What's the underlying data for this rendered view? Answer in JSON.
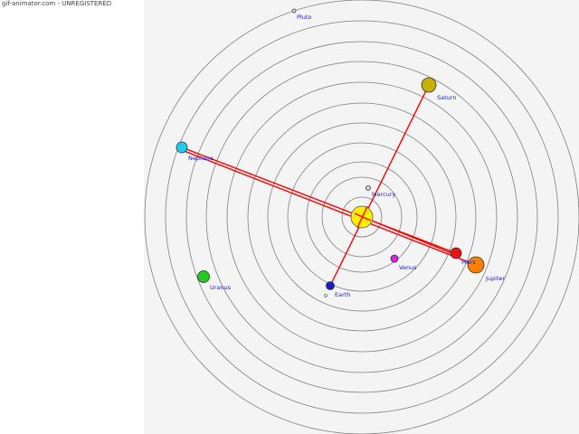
{
  "watermark": "gif-animator.com - UNREGISTERED",
  "colors": {
    "panel_bg": "#f4f4f4",
    "orbit": "#808080",
    "line": "#ff0000",
    "label": "#1a1acc"
  },
  "sun": {
    "color": "#ffee00"
  },
  "planets": [
    {
      "name": "Mercury",
      "color": "#d8d8d8",
      "label": "Mercury"
    },
    {
      "name": "Venus",
      "color": "#e020e0",
      "label": "Venus"
    },
    {
      "name": "Earth",
      "color": "#1a1acc",
      "label": "Earth"
    },
    {
      "name": "Mars",
      "color": "#ee1111",
      "label": "Mars"
    },
    {
      "name": "Jupiter",
      "color": "#ff8000",
      "label": "Jupiter"
    },
    {
      "name": "Saturn",
      "color": "#c8b000",
      "label": "Saturn"
    },
    {
      "name": "Uranus",
      "color": "#22cc22",
      "label": "Uranus"
    },
    {
      "name": "Neptune",
      "color": "#22ccee",
      "label": "Neptune"
    },
    {
      "name": "Pluto",
      "color": "#dddddd",
      "label": "Pluto"
    }
  ],
  "moon": {
    "color": "#ffffff"
  }
}
